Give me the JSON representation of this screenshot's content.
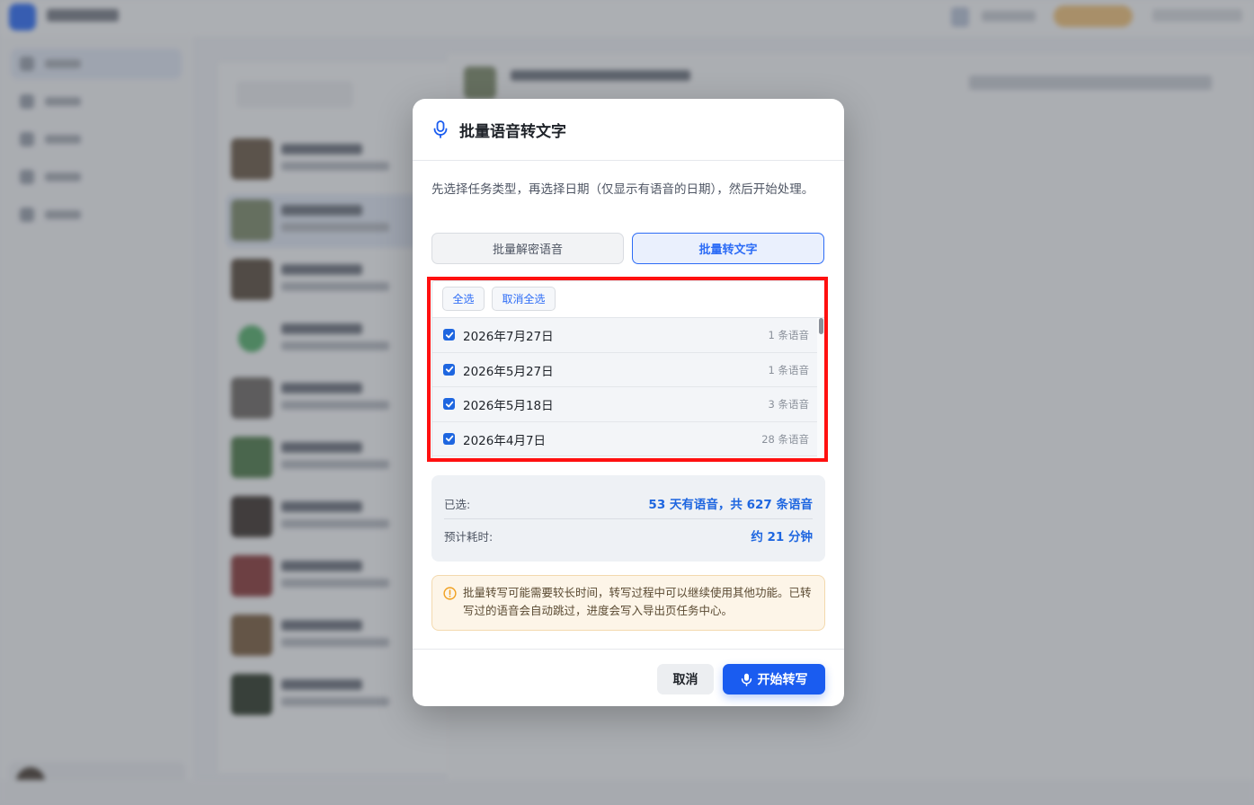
{
  "dialog": {
    "title": "批量语音转文字",
    "description": "先选择任务类型，再选择日期（仅显示有语音的日期），然后开始处理。",
    "tabs": [
      {
        "label": "批量解密语音",
        "active": false
      },
      {
        "label": "批量转文字",
        "active": true
      }
    ],
    "date_panel": {
      "select_all_label": "全选",
      "deselect_all_label": "取消全选",
      "dates": [
        {
          "label": "2026年7月27日",
          "count": "1 条语音",
          "checked": true
        },
        {
          "label": "2026年5月27日",
          "count": "1 条语音",
          "checked": true
        },
        {
          "label": "2026年5月18日",
          "count": "3 条语音",
          "checked": true
        },
        {
          "label": "2026年4月7日",
          "count": "28 条语音",
          "checked": true
        }
      ]
    },
    "summary": {
      "selected_label": "已选:",
      "selected_value": "53 天有语音，共 627 条语音",
      "eta_label": "预计耗时:",
      "eta_value": "约 21 分钟"
    },
    "notice": "批量转写可能需要较长时间，转写过程中可以继续使用其他功能。已转写过的语音会自动跳过，进度会写入导出页任务中心。",
    "buttons": {
      "cancel": "取消",
      "start": "开始转写"
    }
  },
  "colors": {
    "accent": "#1a5cf0",
    "highlight": "#ff1010",
    "notice_bg": "#fdf5e8",
    "notice_icon": "#f0a020"
  },
  "icons": {
    "title": "microphone-icon",
    "notice": "warning-circle-icon",
    "start": "microphone-icon"
  }
}
